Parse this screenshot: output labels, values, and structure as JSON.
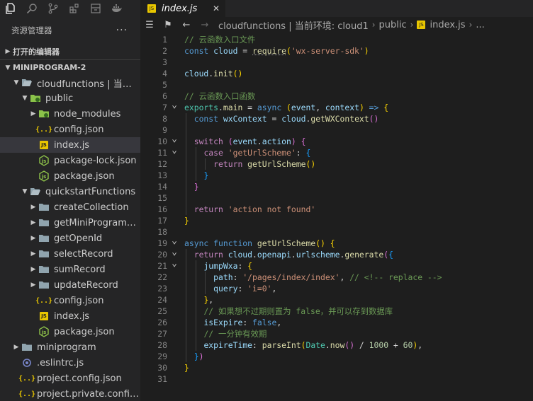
{
  "sidebar": {
    "title": "资源管理器",
    "more": "···",
    "open_editors": "打开的编辑器",
    "workspace": "MINIPROGRAM-2",
    "tree": [
      {
        "label": "cloudfunctions | 当前环...",
        "depth": 1,
        "kind": "folder-open",
        "chevron": "open"
      },
      {
        "label": "public",
        "depth": 2,
        "kind": "folder-green",
        "chevron": "open"
      },
      {
        "label": "node_modules",
        "depth": 3,
        "kind": "folder-green",
        "chevron": "closed"
      },
      {
        "label": "config.json",
        "depth": 3,
        "kind": "json"
      },
      {
        "label": "index.js",
        "depth": 3,
        "kind": "js",
        "selected": true
      },
      {
        "label": "package-lock.json",
        "depth": 3,
        "kind": "npm"
      },
      {
        "label": "package.json",
        "depth": 3,
        "kind": "npm"
      },
      {
        "label": "quickstartFunctions",
        "depth": 2,
        "kind": "folder-open",
        "chevron": "open"
      },
      {
        "label": "createCollection",
        "depth": 3,
        "kind": "folder",
        "chevron": "closed"
      },
      {
        "label": "getMiniProgramCode",
        "depth": 3,
        "kind": "folder",
        "chevron": "closed"
      },
      {
        "label": "getOpenId",
        "depth": 3,
        "kind": "folder",
        "chevron": "closed"
      },
      {
        "label": "selectRecord",
        "depth": 3,
        "kind": "folder",
        "chevron": "closed"
      },
      {
        "label": "sumRecord",
        "depth": 3,
        "kind": "folder",
        "chevron": "closed"
      },
      {
        "label": "updateRecord",
        "depth": 3,
        "kind": "folder",
        "chevron": "closed"
      },
      {
        "label": "config.json",
        "depth": 3,
        "kind": "json"
      },
      {
        "label": "index.js",
        "depth": 3,
        "kind": "js"
      },
      {
        "label": "package.json",
        "depth": 3,
        "kind": "npm"
      },
      {
        "label": "miniprogram",
        "depth": 1,
        "kind": "folder",
        "chevron": "closed"
      },
      {
        "label": ".eslintrc.js",
        "depth": 1,
        "kind": "eslint"
      },
      {
        "label": "project.config.json",
        "depth": 1,
        "kind": "json"
      },
      {
        "label": "project.private.config.js...",
        "depth": 1,
        "kind": "json"
      }
    ]
  },
  "tab": {
    "label": "index.js",
    "icon": "JS",
    "close": "✕"
  },
  "breadcrumb": {
    "segments": [
      "cloudfunctions | 当前环境: cloud1",
      "public",
      "index.js",
      "..."
    ]
  },
  "editor": {
    "lines": [
      {
        "n": "1",
        "tokens": [
          [
            "c-com",
            "// 云函数入口文件"
          ]
        ]
      },
      {
        "n": "2",
        "tokens": [
          [
            "c-kw",
            "const "
          ],
          [
            "c-var",
            "cloud"
          ],
          [
            "c-txt",
            " = "
          ],
          [
            "c-fn c-un",
            "require"
          ],
          [
            "c-b1",
            "("
          ],
          [
            "c-str",
            "'wx-server-sdk'"
          ],
          [
            "c-b1",
            ")"
          ]
        ]
      },
      {
        "n": "3",
        "tokens": []
      },
      {
        "n": "4",
        "tokens": [
          [
            "c-var",
            "cloud"
          ],
          [
            "c-txt",
            "."
          ],
          [
            "c-fn",
            "init"
          ],
          [
            "c-b1",
            "()"
          ]
        ]
      },
      {
        "n": "5",
        "tokens": []
      },
      {
        "n": "6",
        "tokens": [
          [
            "c-com",
            "// 云函数入口函数"
          ]
        ]
      },
      {
        "n": "7",
        "fold": true,
        "tokens": [
          [
            "c-cls",
            "exports"
          ],
          [
            "c-txt",
            "."
          ],
          [
            "c-fn",
            "main"
          ],
          [
            "c-txt",
            " = "
          ],
          [
            "c-kw",
            "async "
          ],
          [
            "c-b1",
            "("
          ],
          [
            "c-par",
            "event"
          ],
          [
            "c-txt",
            ", "
          ],
          [
            "c-par",
            "context"
          ],
          [
            "c-b1",
            ")"
          ],
          [
            "c-kw",
            " => "
          ],
          [
            "c-b1",
            "{"
          ]
        ]
      },
      {
        "n": "8",
        "tokens": [
          [
            "c-txt",
            "  "
          ],
          [
            "c-kw",
            "const "
          ],
          [
            "c-var",
            "wxContext"
          ],
          [
            "c-txt",
            " = "
          ],
          [
            "c-var",
            "cloud"
          ],
          [
            "c-txt",
            "."
          ],
          [
            "c-fn",
            "getWXContext"
          ],
          [
            "c-b2",
            "()"
          ]
        ]
      },
      {
        "n": "9",
        "tokens": []
      },
      {
        "n": "10",
        "fold": true,
        "tokens": [
          [
            "c-txt",
            "  "
          ],
          [
            "c-ctl",
            "switch "
          ],
          [
            "c-b2",
            "("
          ],
          [
            "c-var",
            "event"
          ],
          [
            "c-txt",
            "."
          ],
          [
            "c-var",
            "action"
          ],
          [
            "c-b2",
            ")"
          ],
          [
            "c-txt",
            " "
          ],
          [
            "c-b2",
            "{"
          ]
        ]
      },
      {
        "n": "11",
        "fold": true,
        "tokens": [
          [
            "c-txt",
            "    "
          ],
          [
            "c-ctl",
            "case "
          ],
          [
            "c-str",
            "'getUrlScheme'"
          ],
          [
            "c-txt",
            ": "
          ],
          [
            "c-b3",
            "{"
          ]
        ]
      },
      {
        "n": "12",
        "tokens": [
          [
            "c-txt",
            "      "
          ],
          [
            "c-ctl",
            "return "
          ],
          [
            "c-fn",
            "getUrlScheme"
          ],
          [
            "c-b1",
            "()"
          ]
        ]
      },
      {
        "n": "13",
        "tokens": [
          [
            "c-txt",
            "    "
          ],
          [
            "c-b3",
            "}"
          ]
        ]
      },
      {
        "n": "14",
        "tokens": [
          [
            "c-txt",
            "  "
          ],
          [
            "c-b2",
            "}"
          ]
        ]
      },
      {
        "n": "15",
        "tokens": []
      },
      {
        "n": "16",
        "tokens": [
          [
            "c-txt",
            "  "
          ],
          [
            "c-ctl",
            "return "
          ],
          [
            "c-str",
            "'action not found'"
          ]
        ]
      },
      {
        "n": "17",
        "tokens": [
          [
            "c-b1",
            "}"
          ]
        ]
      },
      {
        "n": "18",
        "tokens": []
      },
      {
        "n": "19",
        "fold": true,
        "tokens": [
          [
            "c-kw",
            "async "
          ],
          [
            "c-kw",
            "function "
          ],
          [
            "c-fn",
            "getUrlScheme"
          ],
          [
            "c-b1",
            "()"
          ],
          [
            "c-txt",
            " "
          ],
          [
            "c-b1",
            "{"
          ]
        ]
      },
      {
        "n": "20",
        "fold": true,
        "tokens": [
          [
            "c-txt",
            "  "
          ],
          [
            "c-ctl",
            "return "
          ],
          [
            "c-var",
            "cloud"
          ],
          [
            "c-txt",
            "."
          ],
          [
            "c-var",
            "openapi"
          ],
          [
            "c-txt",
            "."
          ],
          [
            "c-var",
            "urlscheme"
          ],
          [
            "c-txt",
            "."
          ],
          [
            "c-fn",
            "generate"
          ],
          [
            "c-b2",
            "("
          ],
          [
            "c-b3",
            "{"
          ]
        ]
      },
      {
        "n": "21",
        "fold": true,
        "tokens": [
          [
            "c-txt",
            "    "
          ],
          [
            "c-var",
            "jumpWxa"
          ],
          [
            "c-txt",
            ": "
          ],
          [
            "c-b1",
            "{"
          ]
        ]
      },
      {
        "n": "22",
        "tokens": [
          [
            "c-txt",
            "      "
          ],
          [
            "c-var",
            "path"
          ],
          [
            "c-txt",
            ": "
          ],
          [
            "c-str",
            "'/pages/index/index'"
          ],
          [
            "c-txt",
            ", "
          ],
          [
            "c-com",
            "// <!-- replace -->"
          ]
        ]
      },
      {
        "n": "23",
        "tokens": [
          [
            "c-txt",
            "      "
          ],
          [
            "c-var",
            "query"
          ],
          [
            "c-txt",
            ": "
          ],
          [
            "c-str",
            "'i=0'"
          ],
          [
            "c-txt",
            ","
          ]
        ]
      },
      {
        "n": "24",
        "tokens": [
          [
            "c-txt",
            "    "
          ],
          [
            "c-b1",
            "}"
          ],
          [
            "c-txt",
            ","
          ]
        ]
      },
      {
        "n": "25",
        "tokens": [
          [
            "c-txt",
            "    "
          ],
          [
            "c-com",
            "// 如果想不过期则置为 false，并可以存到数据库"
          ]
        ]
      },
      {
        "n": "26",
        "tokens": [
          [
            "c-txt",
            "    "
          ],
          [
            "c-var",
            "isExpire"
          ],
          [
            "c-txt",
            ": "
          ],
          [
            "c-kw",
            "false"
          ],
          [
            "c-txt",
            ","
          ]
        ]
      },
      {
        "n": "27",
        "tokens": [
          [
            "c-txt",
            "    "
          ],
          [
            "c-com",
            "// 一分钟有效期"
          ]
        ]
      },
      {
        "n": "28",
        "tokens": [
          [
            "c-txt",
            "    "
          ],
          [
            "c-var",
            "expireTime"
          ],
          [
            "c-txt",
            ": "
          ],
          [
            "c-fn",
            "parseInt"
          ],
          [
            "c-b1",
            "("
          ],
          [
            "c-cls",
            "Date"
          ],
          [
            "c-txt",
            "."
          ],
          [
            "c-fn",
            "now"
          ],
          [
            "c-b2",
            "()"
          ],
          [
            "c-txt",
            " / "
          ],
          [
            "c-num",
            "1000"
          ],
          [
            "c-txt",
            " + "
          ],
          [
            "c-num",
            "60"
          ],
          [
            "c-b1",
            ")"
          ],
          [
            "c-txt",
            ","
          ]
        ]
      },
      {
        "n": "29",
        "tokens": [
          [
            "c-txt",
            "  "
          ],
          [
            "c-b3",
            "}"
          ],
          [
            "c-b2",
            ")"
          ]
        ]
      },
      {
        "n": "30",
        "tokens": [
          [
            "c-b1",
            "}"
          ]
        ]
      },
      {
        "n": "31",
        "tokens": []
      }
    ]
  }
}
